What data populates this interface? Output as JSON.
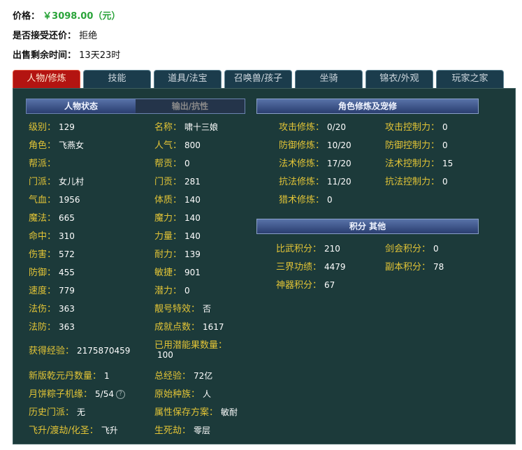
{
  "info": {
    "price_label": "价格：",
    "price_value": "￥3098.00（元）",
    "bargain_label": "是否接受还价：",
    "bargain_value": "拒绝",
    "time_label": "出售剩余时间：",
    "time_value": "13天23时"
  },
  "tabs": [
    "人物/修炼",
    "技能",
    "道具/法宝",
    "召唤兽/孩子",
    "坐骑",
    "锦衣/外观",
    "玩家之家"
  ],
  "subtabs": [
    "人物状态",
    "输出/抗性"
  ],
  "section_titles": {
    "cultivation": "角色修炼及宠修",
    "score": "积分 其他"
  },
  "stats_left": [
    {
      "label": "级别：",
      "value": "129"
    },
    {
      "label": "角色：",
      "value": "飞燕女"
    },
    {
      "label": "帮派：",
      "value": ""
    },
    {
      "label": "门派：",
      "value": "女儿村"
    },
    {
      "label": "气血：",
      "value": "1956"
    },
    {
      "label": "魔法：",
      "value": "665"
    },
    {
      "label": "命中：",
      "value": "310"
    },
    {
      "label": "伤害：",
      "value": "572"
    },
    {
      "label": "防御：",
      "value": "455"
    },
    {
      "label": "速度：",
      "value": "779"
    },
    {
      "label": "法伤：",
      "value": "363"
    },
    {
      "label": "法防：",
      "value": "363"
    }
  ],
  "stats_right": [
    {
      "label": "名称：",
      "value": "啸十三娘"
    },
    {
      "label": "人气：",
      "value": "800"
    },
    {
      "label": "帮贡：",
      "value": "0"
    },
    {
      "label": "门贡：",
      "value": "281"
    },
    {
      "label": "体质：",
      "value": "140"
    },
    {
      "label": "魔力：",
      "value": "140"
    },
    {
      "label": "力量：",
      "value": "140"
    },
    {
      "label": "耐力：",
      "value": "139"
    },
    {
      "label": "敏捷：",
      "value": "901"
    },
    {
      "label": "潜力：",
      "value": "0"
    },
    {
      "label": "靓号特效：",
      "value": "否"
    },
    {
      "label": "成就点数：",
      "value": "1617"
    }
  ],
  "extra": {
    "exp_label": "获得经验：",
    "exp_value": "2175870459",
    "potion_label": "已用潜能果数量：",
    "potion_value": "100",
    "qianyuan_label": "新版乾元丹数量：",
    "qianyuan_value": "1",
    "total_exp_label": "总经验：",
    "total_exp_value": "72亿",
    "mooncake_label": "月饼粽子机缘：",
    "mooncake_value": "5/54",
    "race_label": "原始种族：",
    "race_value": "人",
    "history_label": "历史门派：",
    "history_value": "无",
    "scheme_label": "属性保存方案：",
    "scheme_value": "敏耐",
    "ascend_label": "飞升/渡劫/化圣：",
    "ascend_value": "飞升",
    "life_label": "生死劫：",
    "life_value": "零层"
  },
  "cultivation": [
    {
      "label": "攻击修炼：",
      "value": "0/20",
      "label2": "攻击控制力：",
      "value2": "0"
    },
    {
      "label": "防御修炼：",
      "value": "10/20",
      "label2": "防御控制力：",
      "value2": "0"
    },
    {
      "label": "法术修炼：",
      "value": "17/20",
      "label2": "法术控制力：",
      "value2": "15"
    },
    {
      "label": "抗法修炼：",
      "value": "11/20",
      "label2": "抗法控制力：",
      "value2": "0"
    },
    {
      "label": "猎术修炼：",
      "value": "0",
      "label2": "",
      "value2": ""
    }
  ],
  "scores": [
    {
      "label": "比武积分：",
      "value": "210",
      "label2": "剑会积分：",
      "value2": "0"
    },
    {
      "label": "三界功绩：",
      "value": "4479",
      "label2": "副本积分：",
      "value2": "78"
    },
    {
      "label": "神器积分：",
      "value": "67",
      "label2": "",
      "value2": ""
    }
  ],
  "colors": {
    "label": "#e2c436",
    "value": "#ffffff",
    "panel": "#1c3a3a",
    "active_tab": "#b31411",
    "price": "#2aa43a"
  }
}
